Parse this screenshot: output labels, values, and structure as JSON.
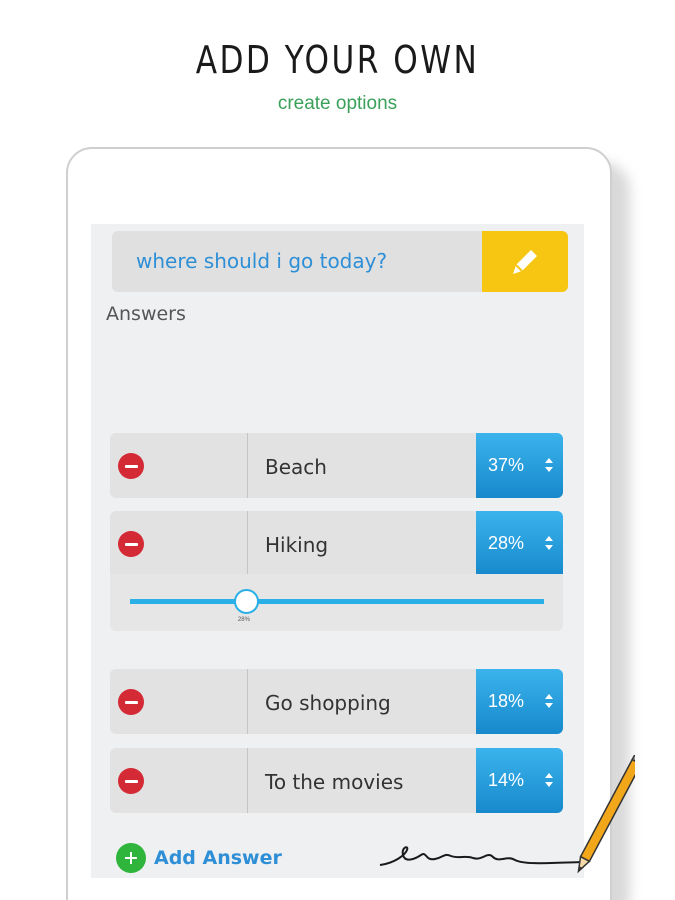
{
  "hero": {
    "title": "ADD YOUR OWN",
    "subtitle": "create options"
  },
  "question": {
    "text": "where should i go today?",
    "edit_icon": "pencil-icon"
  },
  "answers_label": "Answers",
  "answers": [
    {
      "label": "Beach",
      "percent": "37%"
    },
    {
      "label": "Hiking",
      "percent": "28%"
    },
    {
      "label": "Go shopping",
      "percent": "18%"
    },
    {
      "label": "To the movies",
      "percent": "14%"
    }
  ],
  "slider": {
    "value_label": "28%",
    "value": 28
  },
  "add_answer": {
    "label": "Add Answer",
    "icon": "plus-icon"
  },
  "colors": {
    "accent_blue": "#2e8fd6",
    "edit_yellow": "#f7c612",
    "remove_red": "#d42a35",
    "add_green": "#2fb53c",
    "subtitle_green": "#3aa05a"
  }
}
